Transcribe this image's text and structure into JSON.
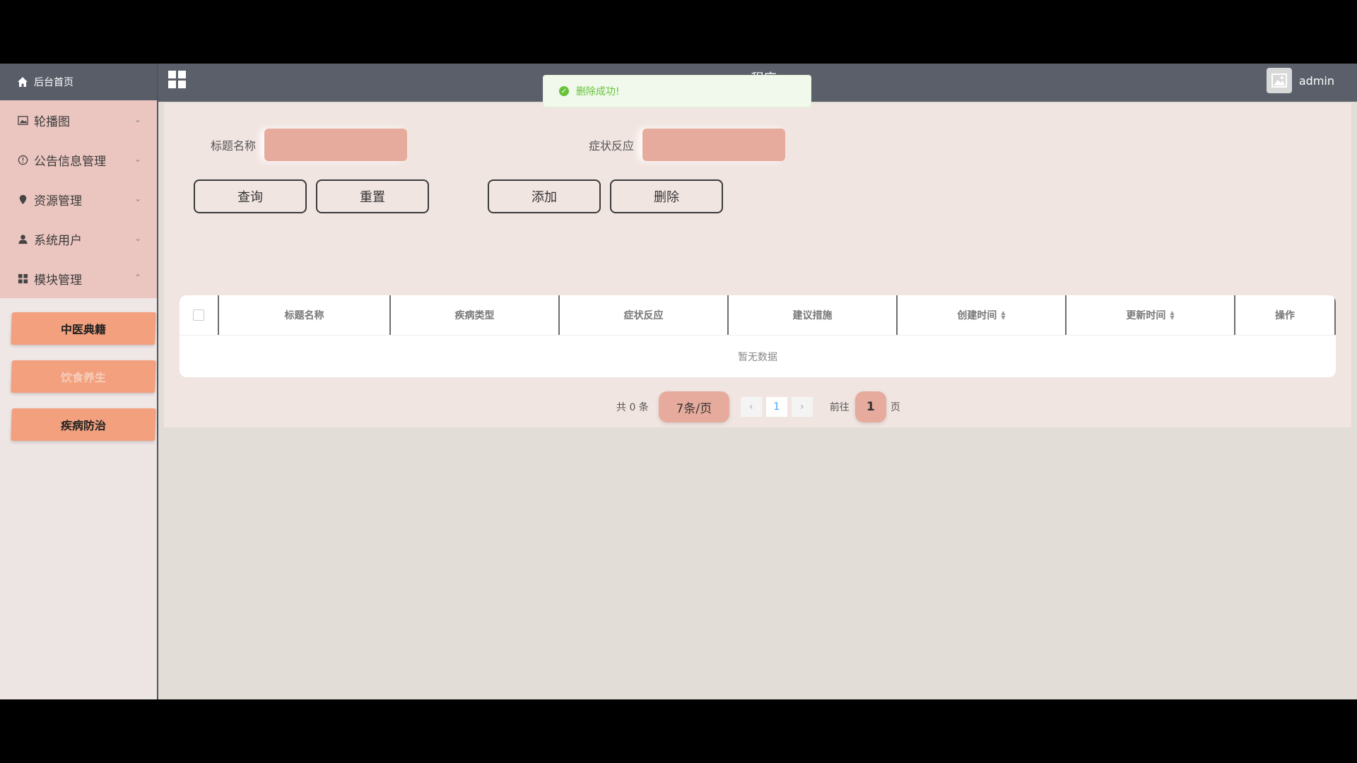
{
  "header": {
    "title": "...程序",
    "username": "admin"
  },
  "sidebar": {
    "home_label": "后台首页",
    "items": [
      {
        "label": "轮播图",
        "icon": "image-icon"
      },
      {
        "label": "公告信息管理",
        "icon": "info-icon"
      },
      {
        "label": "资源管理",
        "icon": "location-icon"
      },
      {
        "label": "系统用户",
        "icon": "user-icon"
      },
      {
        "label": "模块管理",
        "icon": "grid-icon"
      }
    ],
    "submenu": [
      {
        "label": "中医典籍"
      },
      {
        "label": "饮食养生"
      },
      {
        "label": "疾病防治"
      }
    ]
  },
  "search": {
    "title_label": "标题名称",
    "title_value": "",
    "symptom_label": "症状反应",
    "symptom_value": ""
  },
  "buttons": {
    "query": "查询",
    "reset": "重置",
    "add": "添加",
    "delete": "删除"
  },
  "table": {
    "columns": [
      "标题名称",
      "疾病类型",
      "症状反应",
      "建议措施",
      "创建时间",
      "更新时间",
      "操作"
    ],
    "empty_text": "暂无数据"
  },
  "pagination": {
    "total_text": "共 0 条",
    "page_size": "7条/页",
    "current_page": "1",
    "goto_label": "前往",
    "goto_value": "1",
    "page_suffix": "页"
  },
  "toast": {
    "message": "删除成功!",
    "color": "#67c23a"
  }
}
